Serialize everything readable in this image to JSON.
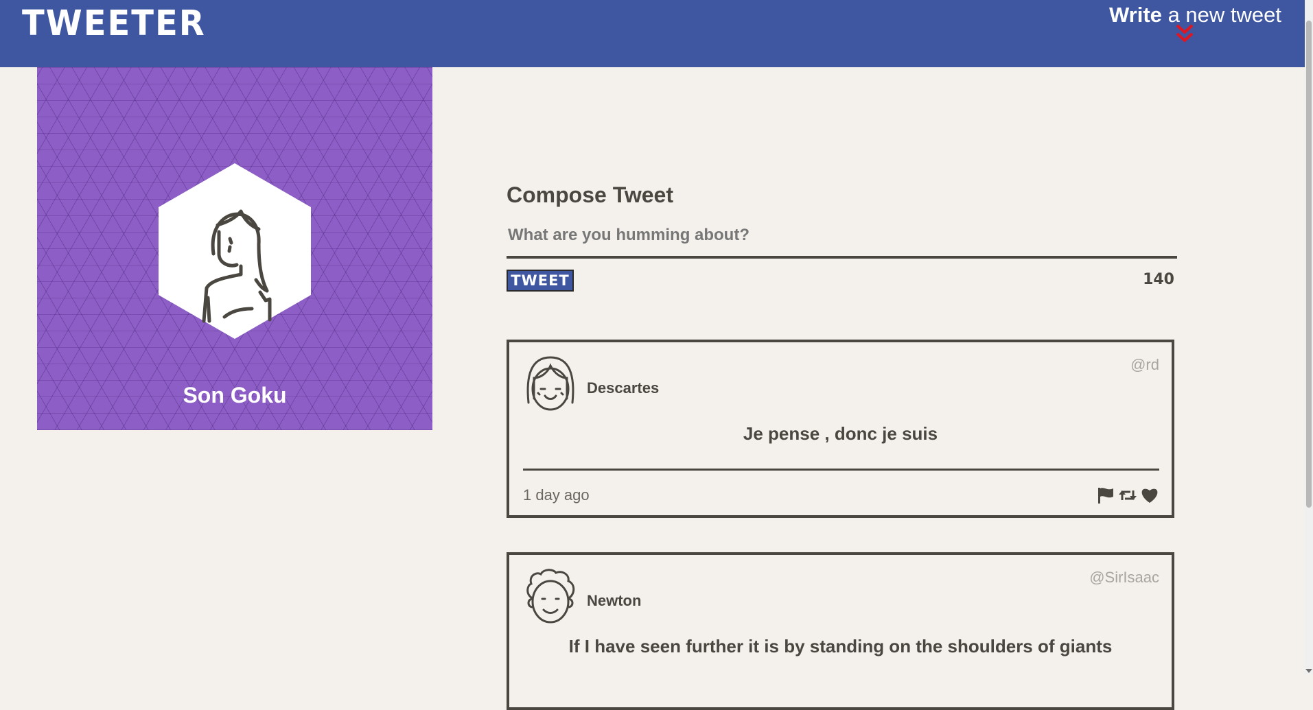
{
  "navbar": {
    "logo": "TWEETER",
    "write_strong": "Write",
    "write_rest": "a new tweet",
    "write_icon": "double-chevron-down-icon",
    "write_icon_color": "#e0151f"
  },
  "profile": {
    "name": "Son Goku",
    "background_color": "#8e5ec7"
  },
  "compose": {
    "title": "Compose Tweet",
    "placeholder": "What are you humming about?",
    "button_label": "TWEET",
    "counter": "140"
  },
  "tweets": [
    {
      "author": "Descartes",
      "handle": "@rd",
      "content": "Je pense , donc je suis",
      "timestamp": "1 day ago",
      "avatar_icon": "girl-bangs-avatar-icon"
    },
    {
      "author": "Newton",
      "handle": "@SirIsaac",
      "content": "If I have seen further it is by standing on the shoulders of giants",
      "avatar_icon": "curly-hair-avatar-icon"
    }
  ],
  "actions": [
    "flag-icon",
    "retweet-icon",
    "heart-icon"
  ],
  "colors": {
    "accent": "#3f57a1",
    "text": "#4a4640",
    "background": "#f4f1ec"
  }
}
